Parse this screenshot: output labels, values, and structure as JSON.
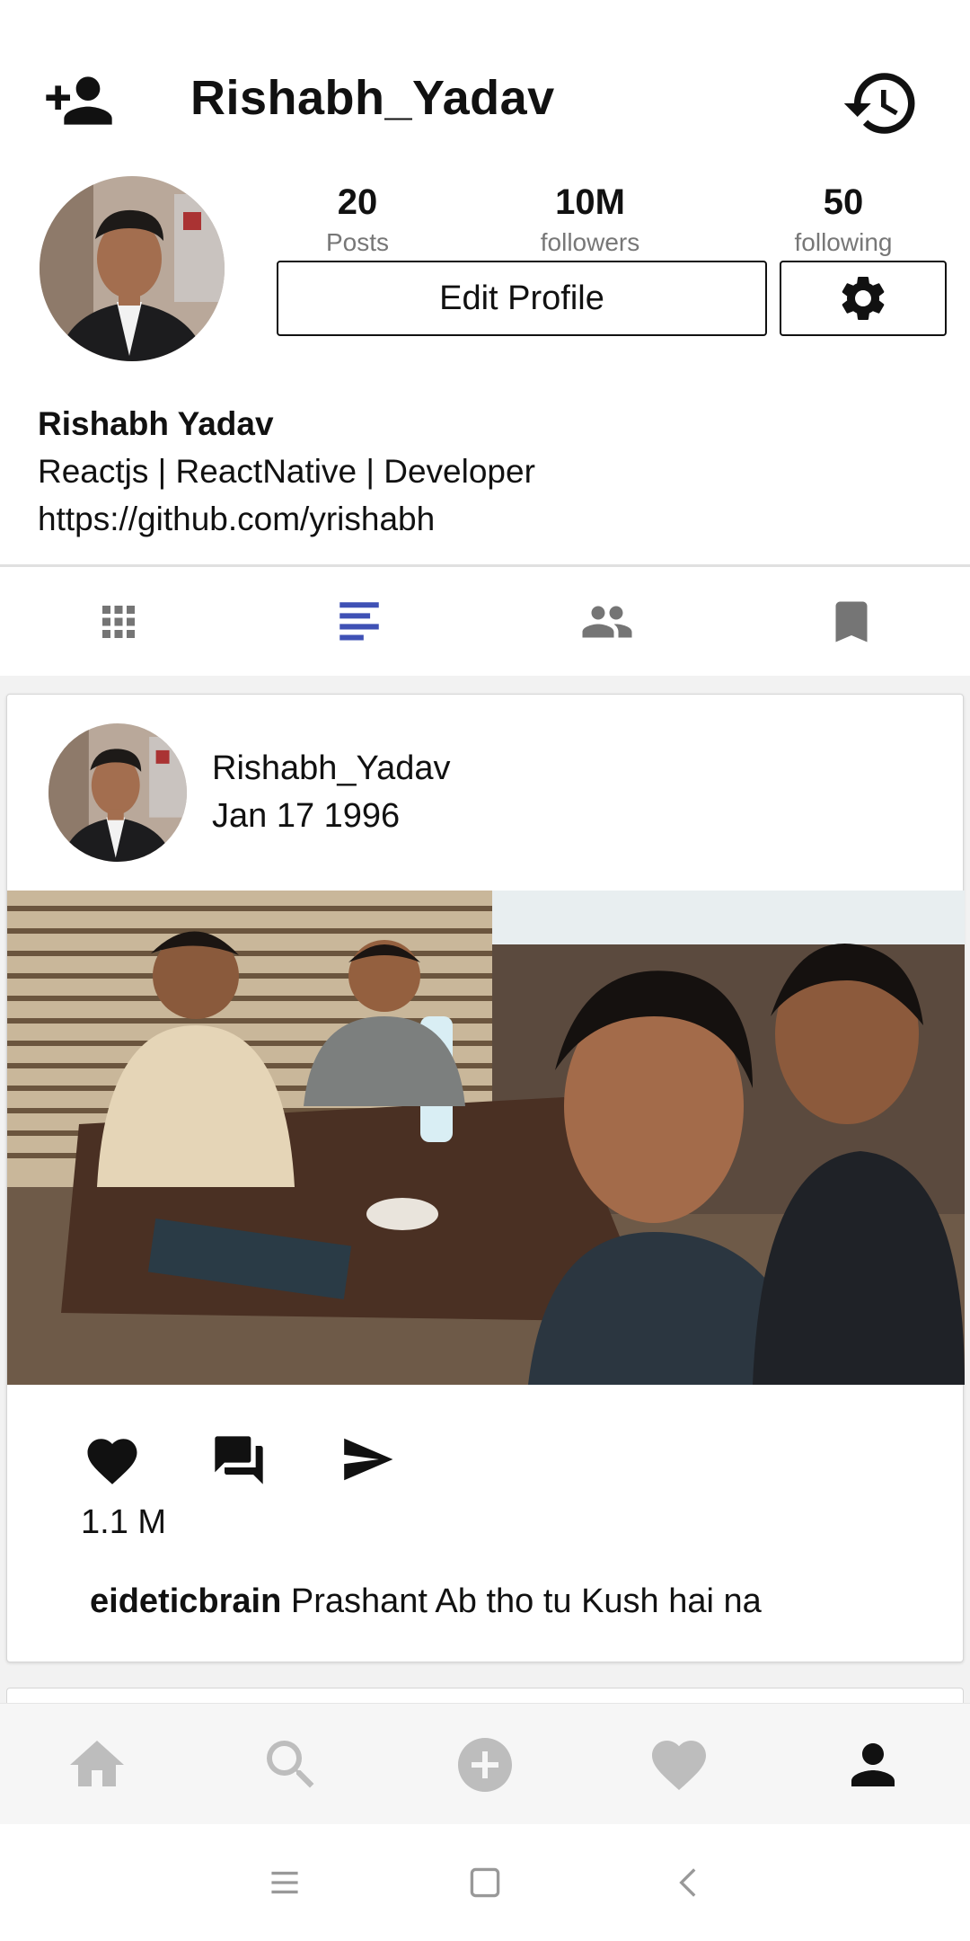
{
  "header": {
    "username": "Rishabh_Yadav",
    "add_user_icon": "person-add-icon",
    "history_icon": "history-icon"
  },
  "profile": {
    "stats": [
      {
        "value": "20",
        "label": "Posts"
      },
      {
        "value": "10M",
        "label": "followers"
      },
      {
        "value": "50",
        "label": "following"
      }
    ],
    "edit_button": "Edit Profile",
    "settings_icon": "gear-icon",
    "full_name": "Rishabh Yadav",
    "bio": "Reactjs | ReactNative | Developer",
    "link": "https://github.com/yrishabh"
  },
  "tabs": [
    {
      "icon": "grid-icon",
      "active": false
    },
    {
      "icon": "list-icon",
      "active": true
    },
    {
      "icon": "people-icon",
      "active": false
    },
    {
      "icon": "bookmark-icon",
      "active": false
    }
  ],
  "post": {
    "username": "Rishabh_Yadav",
    "date": "Jan 17 1996",
    "likes": "1.1 M",
    "caption_user": "eideticbrain",
    "caption_text": "Prashant Ab tho tu Kush hai na",
    "actions": [
      "heart-icon",
      "comment-icon",
      "send-icon"
    ]
  },
  "bottom_nav": [
    {
      "icon": "home-icon",
      "active": false
    },
    {
      "icon": "search-icon",
      "active": false
    },
    {
      "icon": "add-icon",
      "active": false
    },
    {
      "icon": "heart-icon",
      "active": false
    },
    {
      "icon": "profile-icon",
      "active": true
    }
  ],
  "colors": {
    "accent": "#3f51b5",
    "tab_inactive": "#757575",
    "nav_inactive": "#bdbdbd",
    "nav_active": "#111111"
  }
}
